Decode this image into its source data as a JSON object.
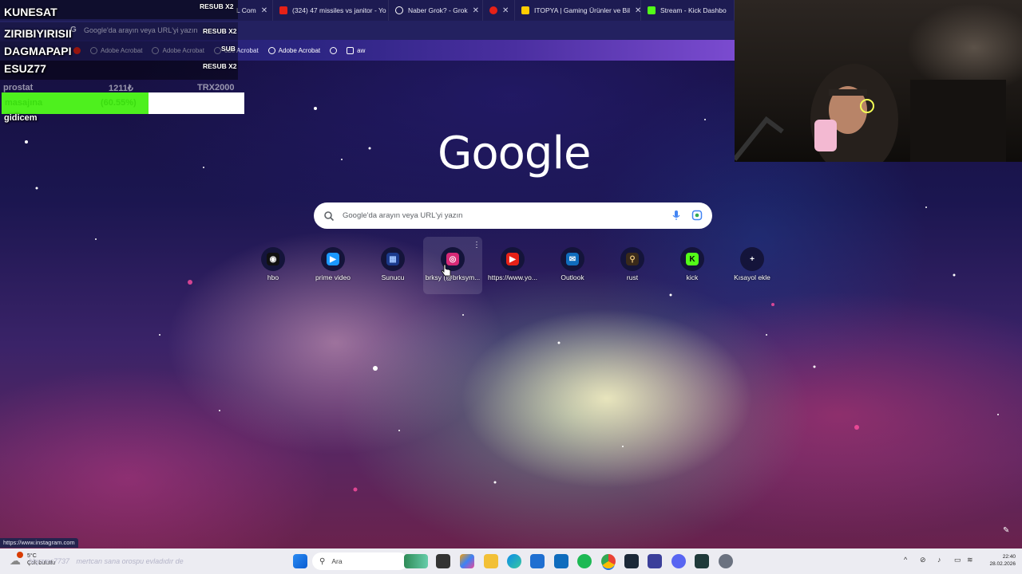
{
  "tabs": [
    {
      "title": "L Com",
      "color": "#888888"
    },
    {
      "title": "(324) 47 missiles vs janitor - Yo",
      "color": "#e62117"
    },
    {
      "title": "Naber Grok? - Grok",
      "color": "#ffffff"
    },
    {
      "title": "",
      "color": "#e62117"
    },
    {
      "title": "ITOPYA | Gaming Ürünler ve Bil",
      "color": "#ffcc00"
    },
    {
      "title": "Stream - Kick Dashbo",
      "color": "#53fc18"
    }
  ],
  "address_bar": {
    "placeholder": "Google'da arayın veya URL'yi yazın"
  },
  "bookmarks": [
    "Adobe Acrobat",
    "Adobe Acrobat",
    "obe Acrobat",
    "Adobe Acrobat",
    "",
    "aw"
  ],
  "overlay": {
    "rows": [
      {
        "name": "KUNESAT",
        "badge": "RESUB X2"
      },
      {
        "name": "ZIRIBIYIRISII",
        "badge": "RESUB X2"
      },
      {
        "name": "DAGMAPAPI",
        "badge": "SUB"
      },
      {
        "name": "ESUZ77",
        "badge": "RESUB X2"
      }
    ],
    "goal_top": {
      "left": "prostat",
      "mid": "1211₺",
      "right": "TRX2000"
    },
    "goal": {
      "label": "masajına",
      "percent_text": "(60.55%)",
      "percent": 60.55
    },
    "caption": "gidicem"
  },
  "google": {
    "logo": "Google",
    "search_placeholder": "Google'da arayın veya URL'yi yazın"
  },
  "shortcuts": [
    {
      "label": "hbo",
      "icon": "hbo-icon",
      "glyph": "◉",
      "color": "#ffffff",
      "bg": "#111111"
    },
    {
      "label": "prime video",
      "icon": "prime-video-icon",
      "glyph": "▶",
      "color": "#ffffff",
      "bg": "#1a98ff"
    },
    {
      "label": "Sunucu",
      "icon": "server-icon",
      "glyph": "▦",
      "color": "#9ec3ff",
      "bg": "#1b3a8c"
    },
    {
      "label": "brksy (@brksym...",
      "icon": "instagram-icon",
      "glyph": "◎",
      "color": "#ffffff",
      "bg": "#d62976"
    },
    {
      "label": "https://www.yo...",
      "icon": "youtube-icon",
      "glyph": "▶",
      "color": "#ffffff",
      "bg": "#e62117"
    },
    {
      "label": "Outlook",
      "icon": "outlook-icon",
      "glyph": "✉",
      "color": "#ffffff",
      "bg": "#0f6cbd"
    },
    {
      "label": "rust",
      "icon": "rust-icon",
      "glyph": "⚲",
      "color": "#e6c27a",
      "bg": "#3a2a1a"
    },
    {
      "label": "kick",
      "icon": "kick-icon",
      "glyph": "K",
      "color": "#0b0b0b",
      "bg": "#53fc18"
    },
    {
      "label": "Kısayol ekle",
      "icon": "plus-icon",
      "glyph": "+",
      "color": "#ffffff",
      "bg": "#14143a"
    }
  ],
  "status_url": "https://www.instagram.com",
  "taskbar": {
    "weather_temp": "5°C",
    "weather_desc": "Çok bulutlu",
    "search_label": "Ara",
    "chat_user": "hbyzmc7737",
    "chat_msg": "mertcan sana orospu evladıdır de",
    "time": "22:40",
    "date": "28.02.2026"
  }
}
